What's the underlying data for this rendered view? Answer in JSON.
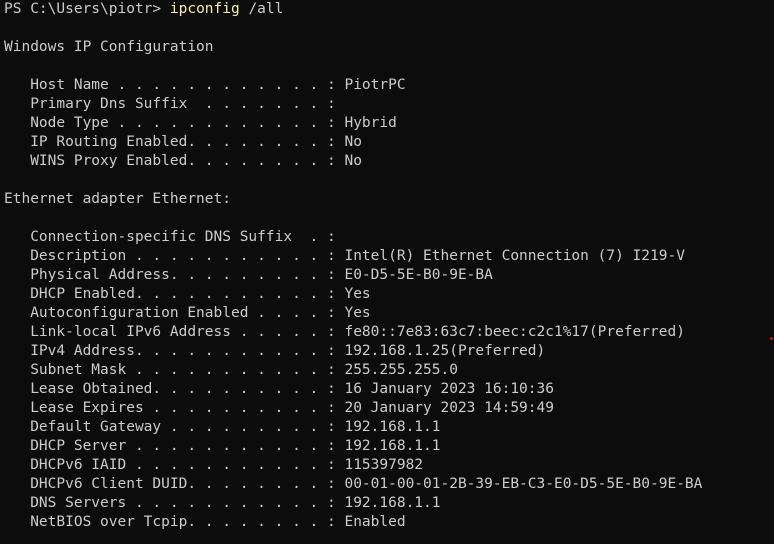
{
  "prompt": {
    "prefix": "PS C:\\Users\\piotr> ",
    "command": "ipconfig",
    "argument": " /all"
  },
  "lines": [
    "",
    "Windows IP Configuration",
    "",
    "   Host Name . . . . . . . . . . . . : PiotrPC",
    "   Primary Dns Suffix  . . . . . . . :",
    "   Node Type . . . . . . . . . . . . : Hybrid",
    "   IP Routing Enabled. . . . . . . . : No",
    "   WINS Proxy Enabled. . . . . . . . : No",
    "",
    "Ethernet adapter Ethernet:",
    "",
    "   Connection-specific DNS Suffix  . :",
    "   Description . . . . . . . . . . . : Intel(R) Ethernet Connection (7) I219-V",
    "   Physical Address. . . . . . . . . : E0-D5-5E-B0-9E-BA",
    "   DHCP Enabled. . . . . . . . . . . : Yes",
    "   Autoconfiguration Enabled . . . . : Yes",
    "   Link-local IPv6 Address . . . . . : fe80::7e83:63c7:beec:c2c1%17(Preferred)",
    "   IPv4 Address. . . . . . . . . . . : 192.168.1.25(Preferred)",
    "   Subnet Mask . . . . . . . . . . . : 255.255.255.0",
    "   Lease Obtained. . . . . . . . . . : 16 January 2023 16:10:36",
    "   Lease Expires . . . . . . . . . . : 20 January 2023 14:59:49",
    "   Default Gateway . . . . . . . . . : 192.168.1.1",
    "   DHCP Server . . . . . . . . . . . : 192.168.1.1",
    "   DHCPv6 IAID . . . . . . . . . . . : 115397982",
    "   DHCPv6 Client DUID. . . . . . . . : 00-01-00-01-2B-39-EB-C3-E0-D5-5E-B0-9E-BA",
    "   DNS Servers . . . . . . . . . . . : 192.168.1.1",
    "   NetBIOS over Tcpip. . . . . . . . : Enabled"
  ],
  "colors": {
    "background": "#0c0c0c",
    "text": "#cccccc",
    "command": "#f9f1a5"
  }
}
